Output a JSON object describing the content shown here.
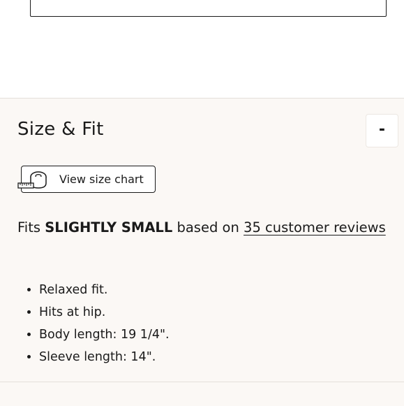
{
  "section": {
    "title": "Size & Fit",
    "toggle_label": "-"
  },
  "size_chart": {
    "label": "View size chart",
    "icon": "measuring-tape-icon"
  },
  "fit": {
    "prefix": "Fits",
    "rating": "SLIGHTLY SMALL",
    "middle": "based on",
    "reviews_link": "35 customer reviews"
  },
  "details": [
    "Relaxed fit.",
    "Hits at hip.",
    "Body length: 19 1/4\".",
    "Sleeve length: 14\"."
  ],
  "colors": {
    "panel_bg": "#fbf8f5",
    "text": "#1a1a1a",
    "divider": "#e4dfda"
  }
}
